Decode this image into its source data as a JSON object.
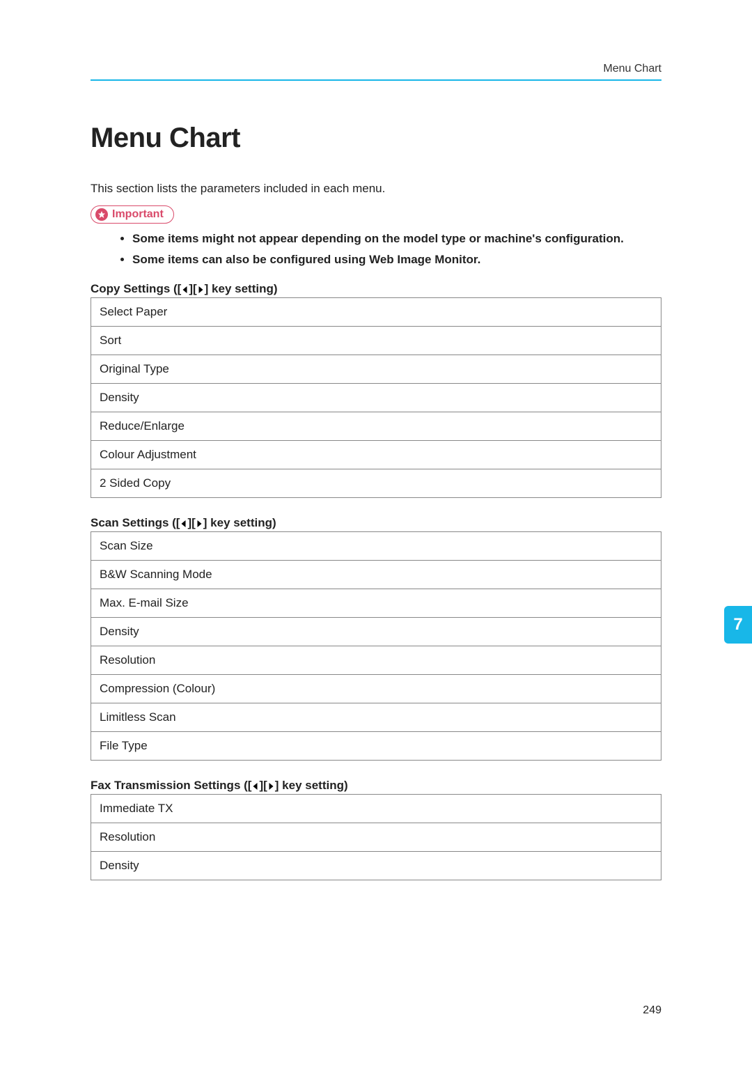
{
  "header": {
    "section_title": "Menu Chart"
  },
  "page_title": "Menu Chart",
  "intro": "This section lists the parameters included in each menu.",
  "important": {
    "label": "Important",
    "bullets": [
      "Some items might not appear depending on the model type or machine's configuration.",
      "Some items can also be configured using Web Image Monitor."
    ]
  },
  "sections": [
    {
      "heading_prefix": "Copy Settings ([",
      "heading_suffix": "] key setting)",
      "items": [
        "Select Paper",
        "Sort",
        "Original Type",
        "Density",
        "Reduce/Enlarge",
        "Colour Adjustment",
        "2 Sided Copy"
      ]
    },
    {
      "heading_prefix": "Scan Settings ([",
      "heading_suffix": "] key setting)",
      "items": [
        "Scan Size",
        "B&W Scanning Mode",
        "Max. E-mail Size",
        "Density",
        "Resolution",
        "Compression (Colour)",
        "Limitless Scan",
        "File Type"
      ]
    },
    {
      "heading_prefix": "Fax Transmission Settings ([",
      "heading_suffix": "] key setting)",
      "items": [
        "Immediate TX",
        "Resolution",
        "Density"
      ]
    }
  ],
  "side_tab": "7",
  "page_number": "249"
}
